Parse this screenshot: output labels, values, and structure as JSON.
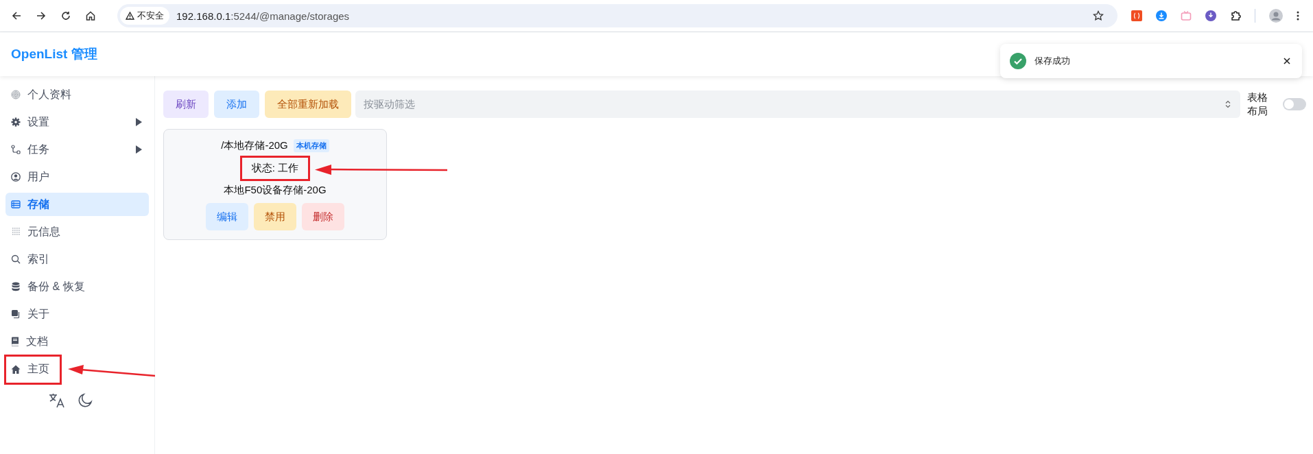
{
  "browser": {
    "security_label": "不安全",
    "url_host": "192.168.0.1",
    "url_rest": ":5244/@manage/storages"
  },
  "header": {
    "title": "OpenList 管理"
  },
  "toast": {
    "message": "保存成功",
    "kind": "success"
  },
  "sidebar": {
    "items": [
      {
        "label": "个人资料",
        "selected": false,
        "has_submenu": false,
        "highlighted": false
      },
      {
        "label": "设置",
        "selected": false,
        "has_submenu": true,
        "highlighted": false
      },
      {
        "label": "任务",
        "selected": false,
        "has_submenu": true,
        "highlighted": false
      },
      {
        "label": "用户",
        "selected": false,
        "has_submenu": false,
        "highlighted": false
      },
      {
        "label": "存储",
        "selected": true,
        "has_submenu": false,
        "highlighted": false
      },
      {
        "label": "元信息",
        "selected": false,
        "has_submenu": false,
        "highlighted": false
      },
      {
        "label": "索引",
        "selected": false,
        "has_submenu": false,
        "highlighted": false
      },
      {
        "label": "备份 & 恢复",
        "selected": false,
        "has_submenu": false,
        "highlighted": false
      },
      {
        "label": "关于",
        "selected": false,
        "has_submenu": false,
        "highlighted": false
      },
      {
        "label": "文档",
        "selected": false,
        "has_submenu": false,
        "highlighted": false
      },
      {
        "label": "主页",
        "selected": false,
        "has_submenu": false,
        "highlighted": true
      }
    ]
  },
  "toolbar": {
    "buttons": [
      {
        "label": "刷新",
        "kind": "refresh"
      },
      {
        "label": "添加",
        "kind": "add"
      },
      {
        "label": "全部重新加载",
        "kind": "reload"
      }
    ],
    "filter": {
      "placeholder": "按驱动筛选"
    },
    "layout_toggle": {
      "label": "表格布局",
      "on": false
    }
  },
  "storages": [
    {
      "mount_path": "/本地存储-20G",
      "driver": "本机存储",
      "status": "状态: 工作",
      "status_highlighted": true,
      "remark": "本地F50设备存储-20G",
      "actions": [
        {
          "label": "编辑",
          "kind": "edit"
        },
        {
          "label": "禁用",
          "kind": "disable"
        },
        {
          "label": "删除",
          "kind": "delete"
        }
      ]
    }
  ]
}
